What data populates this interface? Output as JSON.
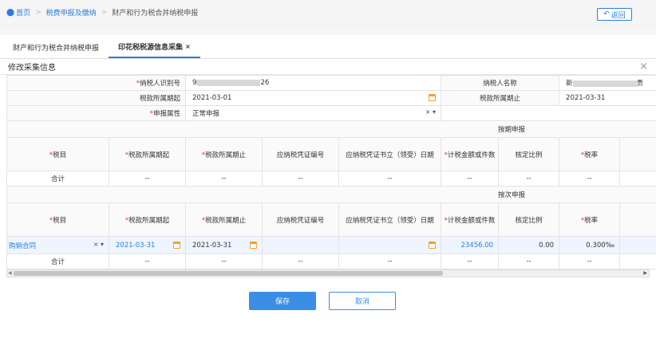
{
  "breadcrumb": {
    "home": "首页",
    "level1": "税费申报及缴纳",
    "level2": "财产和行为税合并纳税申报"
  },
  "back_label": "返回",
  "tabs": [
    {
      "label": "财产和行为税合并纳税申报"
    },
    {
      "label": "印花税税源信息采集",
      "close": "×"
    }
  ],
  "panel_title": "修改采集信息",
  "form": {
    "taxpayer_id_label": "纳税人识别号",
    "taxpayer_id_prefix": "9",
    "taxpayer_id_suffix": "26",
    "taxpayer_name_label": "纳税人名称",
    "taxpayer_name_prefix": "新",
    "taxpayer_name_suffix": "责",
    "period_start_label": "税款所属期起",
    "period_start": "2021-03-01",
    "period_end_label": "税款所属期止",
    "period_end": "2021-03-31",
    "attr_label": "申报属性",
    "attr_value": "正常申报"
  },
  "section_periodic": "按期申报",
  "section_per_item": "按次申报",
  "columns": [
    "税目",
    "税款所属期起",
    "税款所属期止",
    "应纳税凭证编号",
    "应纳税凭证书立（领受）日期",
    "计税金额或件数",
    "核定比例",
    "税率"
  ],
  "required_cols": [
    true,
    true,
    true,
    false,
    false,
    true,
    false,
    true
  ],
  "sum_label": "合计",
  "dash": "--",
  "row": {
    "item": "购销合同",
    "start": "2021-03-31",
    "end": "2021-03-31",
    "voucher": "",
    "date": "",
    "amount": "23456.00",
    "ratio": "0.00",
    "rate": "0.300‰"
  },
  "buttons": {
    "save": "保存",
    "cancel": "取消"
  }
}
